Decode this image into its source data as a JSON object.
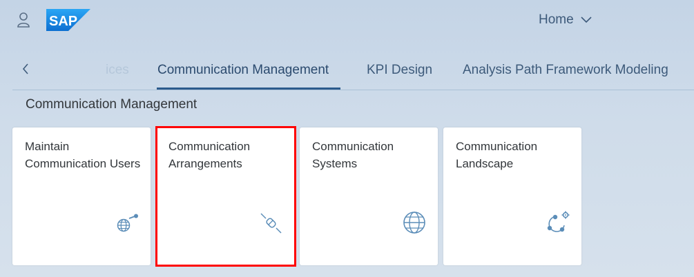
{
  "header": {
    "logo_text": "SAP",
    "home_menu_label": "Home"
  },
  "tabs": {
    "faded_label": "ices",
    "items": [
      {
        "label": "Communication Management",
        "active": true
      },
      {
        "label": "KPI Design",
        "active": false
      },
      {
        "label": "Analysis Path Framework Modeling",
        "active": false
      }
    ]
  },
  "section": {
    "title": "Communication Management"
  },
  "tiles": [
    {
      "title": "Maintain Communication Users",
      "icon": "user-globe-icon"
    },
    {
      "title": "Communication Arrangements",
      "icon": "connector-plug-icon"
    },
    {
      "title": "Communication Systems",
      "icon": "globe-icon"
    },
    {
      "title": "Communication Landscape",
      "icon": "network-gear-icon"
    }
  ],
  "colors": {
    "accent": "#2b5a8c",
    "icon": "#5b8db8",
    "logo_blue": "#1e90ff",
    "highlight": "#ff0000"
  }
}
